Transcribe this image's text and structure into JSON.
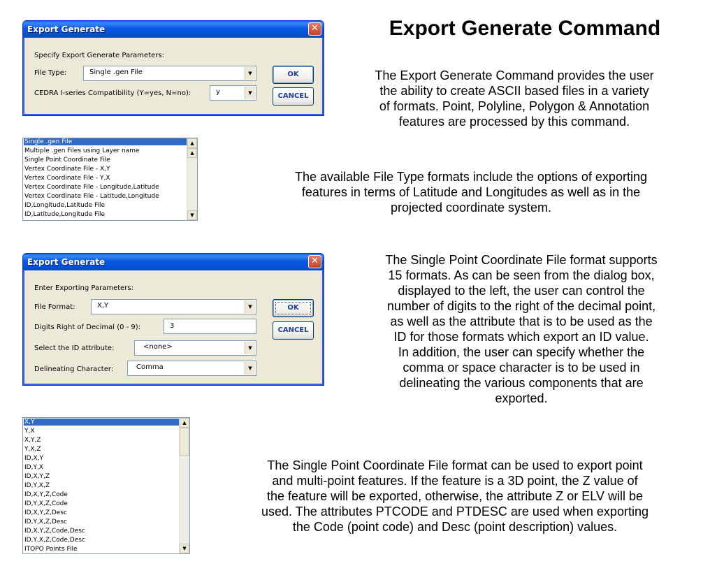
{
  "dialog1": {
    "title": "Export Generate",
    "close": "✕",
    "prompt": "Specify Export Generate Parameters:",
    "file_type_label": "File Type:",
    "file_type_value": "Single .gen File",
    "cedra_label": "CEDRA I-series Compatibility (Y=yes, N=no):",
    "cedra_value": "y",
    "ok": "OK",
    "cancel": "CANCEL"
  },
  "file_type_list": {
    "items": [
      "Single .gen File",
      "Multiple .gen Files using Layer name",
      "Single Point Coordinate File",
      "Vertex Coordinate File - X,Y",
      "Vertex Coordinate File - Y,X",
      "Vertex Coordinate File - Longitude,Latitude",
      "Vertex Coordinate File - Latitude,Longitude",
      "ID,Longitude,Latitude File",
      "ID,Latitude,Longitude File"
    ],
    "selected": 0
  },
  "dialog2": {
    "title": "Export Generate",
    "close": "✕",
    "prompt": "Enter Exporting Parameters:",
    "file_format_label": "File Format:",
    "file_format_value": "X,Y",
    "digits_label": "Digits Right of Decimal (0 - 9):",
    "digits_value": "3",
    "id_attr_label": "Select the ID attribute:",
    "id_attr_value": "<none>",
    "delim_label": "Delineating Character:",
    "delim_value": "Comma",
    "ok": "OK",
    "cancel": "CANCEL"
  },
  "format_list": {
    "items": [
      "X,Y",
      "Y,X",
      "X,Y,Z",
      "Y,X,Z",
      "ID,X,Y",
      "ID,Y,X",
      "ID,X,Y,Z",
      "ID,Y,X,Z",
      "ID,X,Y,Z,Code",
      "ID,Y,X,Z,Code",
      "ID,X,Y,Z,Desc",
      "ID,Y,X,Z,Desc",
      "ID,X,Y,Z,Code,Desc",
      "ID,Y,X,Z,Code,Desc",
      "ITOPO Points File"
    ],
    "selected": 0
  },
  "text": {
    "heading": "Export Generate Command",
    "para1": [
      "The Export Generate Command provides the user",
      "the ability to create ASCII based files in a variety",
      "of formats.  Point, Polyline, Polygon & Annotation",
      "features are processed by this command."
    ],
    "para2": [
      "The available File Type formats include the options of exporting",
      "features in terms of Latitude and Longitudes as well as in the",
      "projected coordinate system."
    ],
    "para3": [
      "The Single Point Coordinate File format supports",
      "15 formats.  As can be seen from the dialog box,",
      "displayed to the left, the user can control the",
      "number of digits to the right of the decimal point,",
      "as well as the attribute that is to be used as the",
      "ID for those formats which export an ID value.",
      "In addition, the user can specify whether the",
      "comma or space character is to be used in",
      "delineating the various components that are",
      "exported."
    ],
    "para4": [
      "The Single Point Coordinate File format can be used to export point",
      "and multi-point features.  If the feature is a 3D point, the Z value of",
      "the feature will be exported, otherwise, the attribute Z or ELV will be",
      "used.  The attributes PTCODE and PTDESC are used when exporting",
      "the Code (point code) and Desc (point description) values."
    ]
  },
  "colors": {
    "titlebar": "#0a58e3",
    "selection": "#316ac5",
    "dialog_face": "#ece9d8",
    "button_text": "#1f3f97"
  }
}
